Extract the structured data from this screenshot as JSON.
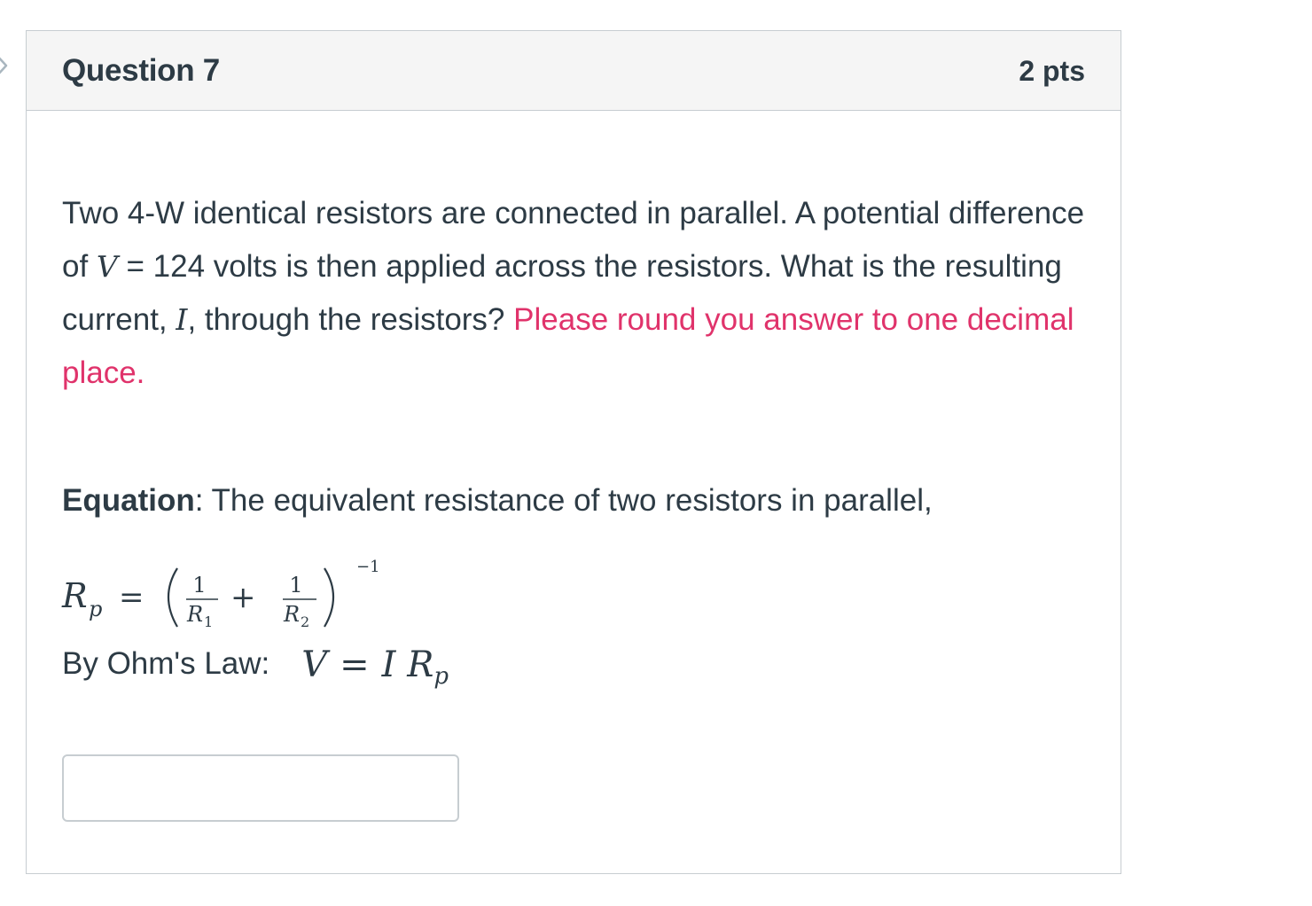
{
  "question": {
    "title": "Question 7",
    "points": "2 pts"
  },
  "body": {
    "text_intro": "Two 4-W identical resistors are connected in parallel.  A potential difference of ",
    "var_v": "V",
    "text_v_value": " = 124 volts is then applied across the resistors.  What is the resulting current, ",
    "var_i": "I",
    "text_after_i": ", through the resistors? ",
    "highlight_text": "Please round you answer to one decimal place."
  },
  "equation": {
    "label": "Equation",
    "text": ":  The equivalent resistance of two resistors in parallel,",
    "rp_lhs": "R",
    "rp_sub": "p",
    "equals": "=",
    "numerator_1": "1",
    "denominator_1": "R",
    "denominator_1_sub": "1",
    "plus": "+",
    "numerator_2": "1",
    "denominator_2": "R",
    "denominator_2_sub": "2",
    "exponent": "−1"
  },
  "ohm": {
    "label": "By Ohm's Law:",
    "v": "V",
    "equals": "=",
    "i": "I",
    "r": "R",
    "r_sub": "p"
  },
  "answer": {
    "value": "",
    "placeholder": ""
  },
  "icons": {
    "nav_arrow": "chevron-right-icon"
  },
  "colors": {
    "highlight": "#e0336b",
    "text": "#2d3b45",
    "header_bg": "#f5f5f5",
    "border": "#c7cdd1"
  }
}
